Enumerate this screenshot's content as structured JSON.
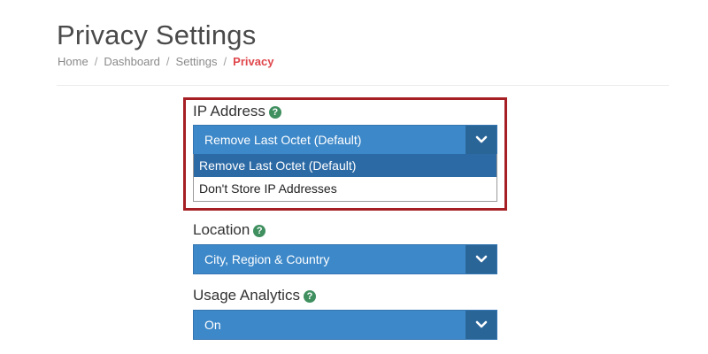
{
  "header": {
    "title": "Privacy Settings",
    "breadcrumb": {
      "home": "Home",
      "dashboard": "Dashboard",
      "settings": "Settings",
      "current": "Privacy",
      "separator": "/"
    }
  },
  "fields": {
    "ip_address": {
      "label": "IP Address",
      "help": "?",
      "selected": "Remove Last Octet (Default)",
      "expanded": true,
      "options": [
        "Remove Last Octet (Default)",
        "Don't Store IP Addresses"
      ]
    },
    "location": {
      "label": "Location",
      "help": "?",
      "selected": "City, Region & Country"
    },
    "usage_analytics": {
      "label": "Usage Analytics",
      "help": "?",
      "selected": "On"
    }
  },
  "icons": {
    "help": "question-circle-icon",
    "dropdown_arrow": "chevron-down-icon"
  },
  "colors": {
    "select_background": "#3d88c9",
    "select_arrow_background": "#2a6598",
    "selected_option": "#2c6aa5",
    "help_icon": "#3f8f5f",
    "breadcrumb_active": "#e0474c",
    "highlight_border": "#a51f24"
  }
}
